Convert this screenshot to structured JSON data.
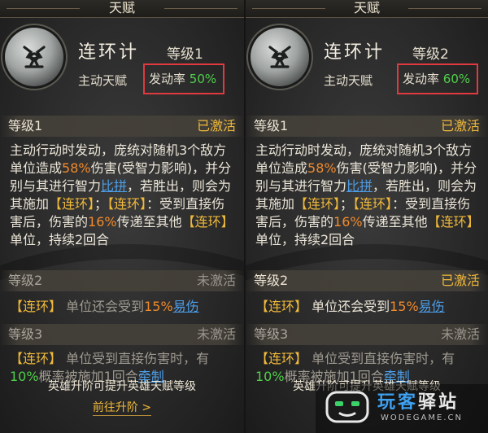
{
  "panels": [
    {
      "header_title": "天赋",
      "skill_name": "连环计",
      "level_label": "等级1",
      "skill_type": "主动天赋",
      "rate_label": "发动率",
      "rate_value": "50%",
      "sections": [
        {
          "level": "等级1",
          "status": "已激活",
          "desc_parts": [
            {
              "t": "主动行动时发动，庞统对随机3个敌方单位造成",
              "c": ""
            },
            {
              "t": "58%",
              "c": "orange"
            },
            {
              "t": "伤害(受智力影响)，并分别与其进行智力",
              "c": ""
            },
            {
              "t": "比拼",
              "c": "blue"
            },
            {
              "t": "，若胜出，则会为其施加",
              "c": ""
            },
            {
              "t": "【连环】",
              "c": "tag"
            },
            {
              "t": "；",
              "c": ""
            },
            {
              "t": "【连环】",
              "c": "tag"
            },
            {
              "t": "：受到直接伤害后，伤害的",
              "c": ""
            },
            {
              "t": "16%",
              "c": "orange"
            },
            {
              "t": "传递至其他",
              "c": ""
            },
            {
              "t": "【连环】",
              "c": "tag"
            },
            {
              "t": "单位，持续2回合",
              "c": ""
            }
          ]
        },
        {
          "level": "等级2",
          "status": "未激活",
          "desc_parts": [
            {
              "t": "【连环】",
              "c": "tag"
            },
            {
              "t": " 单位还会受到",
              "c": ""
            },
            {
              "t": "15%",
              "c": "orange"
            },
            {
              "t": "易伤",
              "c": "blue"
            }
          ]
        },
        {
          "level": "等级3",
          "status": "未激活",
          "desc_parts": [
            {
              "t": "【连环】",
              "c": "tag"
            },
            {
              "t": " 单位受到直接伤害时，有",
              "c": ""
            },
            {
              "t": "10%",
              "c": "green"
            },
            {
              "t": "概率被施加1回合",
              "c": ""
            },
            {
              "t": "牵制",
              "c": "blue"
            }
          ]
        }
      ],
      "footer_note": "英雄升阶可提升英雄天赋等级",
      "footer_button": "前往升阶 >"
    },
    {
      "header_title": "天赋",
      "skill_name": "连环计",
      "level_label": "等级2",
      "skill_type": "主动天赋",
      "rate_label": "发动率",
      "rate_value": "60%",
      "sections": [
        {
          "level": "等级1",
          "status": "已激活",
          "desc_parts": [
            {
              "t": "主动行动时发动，庞统对随机3个敌方单位造成",
              "c": ""
            },
            {
              "t": "58%",
              "c": "orange"
            },
            {
              "t": "伤害(受智力影响)，并分别与其进行智力",
              "c": ""
            },
            {
              "t": "比拼",
              "c": "blue"
            },
            {
              "t": "，若胜出，则会为其施加",
              "c": ""
            },
            {
              "t": "【连环】",
              "c": "tag"
            },
            {
              "t": "；",
              "c": ""
            },
            {
              "t": "【连环】",
              "c": "tag"
            },
            {
              "t": "：受到直接伤害后，伤害的",
              "c": ""
            },
            {
              "t": "16%",
              "c": "orange"
            },
            {
              "t": "传递至其他",
              "c": ""
            },
            {
              "t": "【连环】",
              "c": "tag"
            },
            {
              "t": "单位，持续2回合",
              "c": ""
            }
          ]
        },
        {
          "level": "等级2",
          "status": "已激活",
          "desc_parts": [
            {
              "t": "【连环】",
              "c": "tag"
            },
            {
              "t": " 单位还会受到",
              "c": ""
            },
            {
              "t": "15%",
              "c": "orange"
            },
            {
              "t": "易伤",
              "c": "blue"
            }
          ]
        },
        {
          "level": "等级3",
          "status": "未激活",
          "desc_parts": [
            {
              "t": "【连环】",
              "c": "tag"
            },
            {
              "t": " 单位受到直接伤害时，有",
              "c": ""
            },
            {
              "t": "10%",
              "c": "green"
            },
            {
              "t": "概率被施加1回合",
              "c": ""
            },
            {
              "t": "牵制",
              "c": "blue"
            }
          ]
        }
      ],
      "footer_note": "英雄升阶可提升英雄天赋等级"
    }
  ],
  "watermark": {
    "title_a": "玩客",
    "title_b": "驿站",
    "subtitle": "WODEGAME.CN"
  }
}
